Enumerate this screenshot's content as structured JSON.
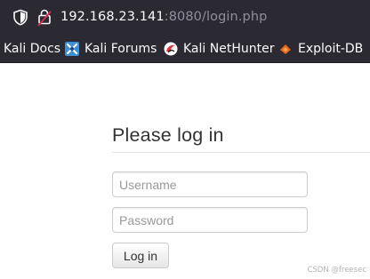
{
  "urlbar": {
    "host": "192.168.23.141",
    "path": ":8080/login.php"
  },
  "bookmarks": [
    {
      "label": "Kali Docs",
      "icon": "kali-docs-icon"
    },
    {
      "label": "Kali Forums",
      "icon": "kali-forums-icon"
    },
    {
      "label": "Kali NetHunter",
      "icon": "kali-nethunter-icon"
    },
    {
      "label": "Exploit-DB",
      "icon": "exploit-db-icon"
    }
  ],
  "login": {
    "title": "Please log in",
    "username_placeholder": "Username",
    "password_placeholder": "Password",
    "button_label": "Log in"
  },
  "watermark": "CSDN @freesec",
  "colors": {
    "toolbar_bg": "#2b2a33",
    "url_host": "#fbfbfe",
    "url_path": "#8f8f9d",
    "page_bg": "#ffffff"
  }
}
